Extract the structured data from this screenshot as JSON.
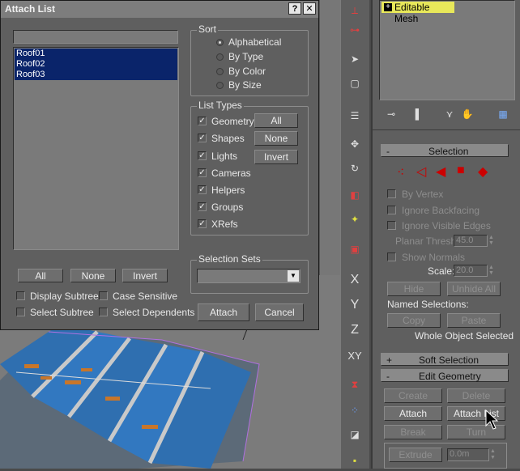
{
  "dialog": {
    "title": "Attach List",
    "help_glyph": "?",
    "close_glyph": "✕",
    "filter_value": "",
    "items": [
      "Roof01",
      "Roof02",
      "Roof03"
    ],
    "sort": {
      "label": "Sort",
      "options": [
        "Alphabetical",
        "By Type",
        "By Color",
        "By Size"
      ],
      "selected": "Alphabetical"
    },
    "list_types": {
      "label": "List Types",
      "items": [
        {
          "label": "Geometry",
          "checked": true
        },
        {
          "label": "Shapes",
          "checked": true
        },
        {
          "label": "Lights",
          "checked": true
        },
        {
          "label": "Cameras",
          "checked": true
        },
        {
          "label": "Helpers",
          "checked": true
        },
        {
          "label": "Groups",
          "checked": true
        },
        {
          "label": "XRefs",
          "checked": true
        }
      ],
      "all_label": "All",
      "none_label": "None",
      "invert_label": "Invert"
    },
    "selection_sets_label": "Selection Sets",
    "selection_sets_value": "",
    "bottom": {
      "all_label": "All",
      "none_label": "None",
      "invert_label": "Invert",
      "display_subtree": "Display Subtree",
      "case_sensitive": "Case Sensitive",
      "select_subtree": "Select Subtree",
      "select_dependents": "Select Dependents",
      "attach_label": "Attach",
      "cancel_label": "Cancel"
    }
  },
  "modifier_stack": {
    "item": "Editable Mesh",
    "expand_glyph": "+"
  },
  "selection_rollout": {
    "title": "Selection",
    "collapse_glyph": "-",
    "by_vertex": "By Vertex",
    "ignore_backfacing": "Ignore Backfacing",
    "ignore_visible_edges": "Ignore Visible Edges",
    "planar_thresh_label": "Planar Thresh:",
    "planar_thresh_value": "45.0",
    "show_normals": "Show Normals",
    "scale_label": "Scale:",
    "scale_value": "20.0",
    "hide": "Hide",
    "unhide_all": "Unhide All",
    "named_selections": "Named Selections:",
    "copy": "Copy",
    "paste": "Paste",
    "status": "Whole Object Selected"
  },
  "soft_selection": {
    "title": "Soft Selection",
    "glyph": "+"
  },
  "edit_geometry": {
    "title": "Edit Geometry",
    "glyph": "-",
    "create": "Create",
    "delete": "Delete",
    "attach": "Attach",
    "attach_list": "Attach List",
    "break": "Break",
    "turn": "Turn",
    "extrude": "Extrude",
    "extrude_value": "0.0m"
  },
  "toolbar": {
    "axis_x": "X",
    "axis_y": "Y",
    "axis_z": "Z",
    "axis_xy": "XY"
  },
  "colors": {
    "accent_blue": "#0a246a",
    "subobj_red": "#cc0000",
    "stack_yellow": "#e8e85a"
  }
}
